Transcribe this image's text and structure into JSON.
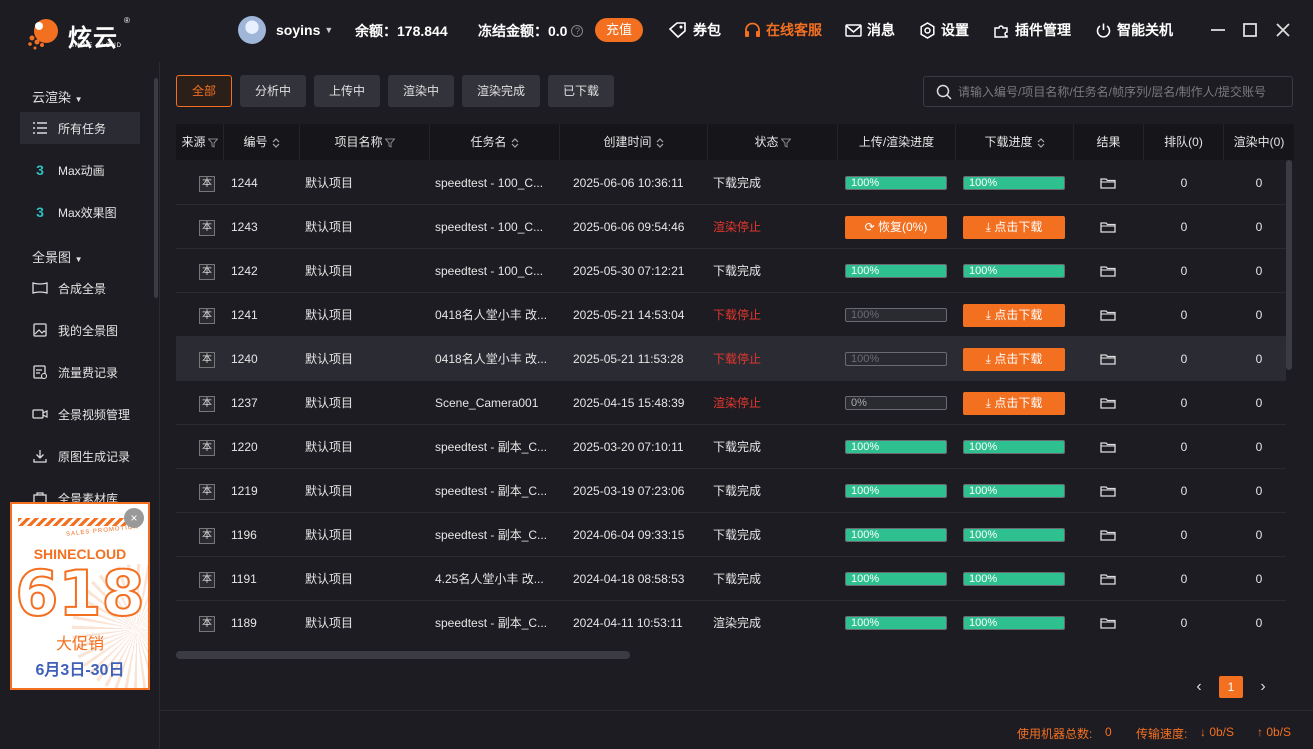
{
  "app": {
    "brand": "炫云",
    "brand_sub": "SHINE CLOUD",
    "brand_reg": "®"
  },
  "header": {
    "username": "soyins",
    "balance": "余额：178.844",
    "frozen": "冻结金额：0.0",
    "help_mark": "?",
    "recharge": "充值",
    "nav": {
      "coupon": "券包",
      "support": "在线客服",
      "message": "消息",
      "settings": "设置",
      "plugins": "插件管理",
      "shutdown": "智能关机"
    }
  },
  "sidebar": {
    "group_cloud": "云渲染",
    "all_tasks": "所有任务",
    "max_anim": "Max动画",
    "max_effect": "Max效果图",
    "group_pano": "全景图",
    "compose": "合成全景",
    "my_pano": "我的全景图",
    "traffic": "流量费记录",
    "video": "全景视频管理",
    "origin": "原图生成记录",
    "material": "全景素材库"
  },
  "promo": {
    "small": "SALES PROMOTION",
    "brand": "SHINECLOUD",
    "big": "618",
    "sale": "大促销",
    "date": "6月3日-30日",
    "close": "×"
  },
  "filters": [
    "全部",
    "分析中",
    "上传中",
    "渲染中",
    "渲染完成",
    "已下载"
  ],
  "search": {
    "placeholder": "请输入编号/项目名称/任务名/帧序列/层名/制作人/提交账号"
  },
  "columns": {
    "source": "来源",
    "id": "编号",
    "project": "项目名称",
    "task": "任务名",
    "created": "创建时间",
    "status": "状态",
    "progress": "上传/渲染进度",
    "download": "下载进度",
    "result": "结果",
    "queued": "排队(0)",
    "rendering": "渲染中(0)"
  },
  "rows": [
    {
      "src": "本",
      "id": "1244",
      "project": "默认项目",
      "task": "speedtest - 100_C...",
      "created": "2025-06-06 10:36:11",
      "status": "下载完成",
      "status_type": "normal",
      "progress": {
        "type": "bar",
        "value": 100,
        "text": "100%"
      },
      "download": {
        "type": "bar",
        "value": 100,
        "text": "100%"
      },
      "queued": "0",
      "rendering": "0"
    },
    {
      "src": "本",
      "id": "1243",
      "project": "默认项目",
      "task": "speedtest - 100_C...",
      "created": "2025-06-06 09:54:46",
      "status": "渲染停止",
      "status_type": "red",
      "progress": {
        "type": "button",
        "text": "恢复(0%)"
      },
      "download": {
        "type": "button",
        "text": "点击下载"
      },
      "queued": "0",
      "rendering": "0"
    },
    {
      "src": "本",
      "id": "1242",
      "project": "默认项目",
      "task": "speedtest - 100_C...",
      "created": "2025-05-30 07:12:21",
      "status": "下载完成",
      "status_type": "normal",
      "progress": {
        "type": "bar",
        "value": 100,
        "text": "100%"
      },
      "download": {
        "type": "bar",
        "value": 100,
        "text": "100%"
      },
      "queued": "0",
      "rendering": "0"
    },
    {
      "src": "本",
      "id": "1241",
      "project": "默认项目",
      "task": "0418名人堂小丰 改...",
      "created": "2025-05-21 14:53:04",
      "status": "下载停止",
      "status_type": "red",
      "progress": {
        "type": "bar",
        "value": 0,
        "text": "100%",
        "style": "empty"
      },
      "download": {
        "type": "button",
        "text": "点击下载"
      },
      "queued": "0",
      "rendering": "0"
    },
    {
      "src": "本",
      "id": "1240",
      "project": "默认项目",
      "task": "0418名人堂小丰 改...",
      "created": "2025-05-21 11:53:28",
      "status": "下载停止",
      "status_type": "red",
      "progress": {
        "type": "bar",
        "value": 0,
        "text": "100%",
        "style": "empty"
      },
      "download": {
        "type": "button",
        "text": "点击下载"
      },
      "queued": "0",
      "rendering": "0",
      "highlight": true
    },
    {
      "src": "本",
      "id": "1237",
      "project": "默认项目",
      "task": "Scene_Camera001",
      "created": "2025-04-15 15:48:39",
      "status": "渲染停止",
      "status_type": "red",
      "progress": {
        "type": "bar",
        "value": 0,
        "text": "0%",
        "style": "zero"
      },
      "download": {
        "type": "button",
        "text": "点击下载"
      },
      "queued": "0",
      "rendering": "0"
    },
    {
      "src": "本",
      "id": "1220",
      "project": "默认项目",
      "task": "speedtest - 副本_C...",
      "created": "2025-03-20 07:10:11",
      "status": "下载完成",
      "status_type": "normal",
      "progress": {
        "type": "bar",
        "value": 100,
        "text": "100%"
      },
      "download": {
        "type": "bar",
        "value": 100,
        "text": "100%"
      },
      "queued": "0",
      "rendering": "0"
    },
    {
      "src": "本",
      "id": "1219",
      "project": "默认项目",
      "task": "speedtest - 副本_C...",
      "created": "2025-03-19 07:23:06",
      "status": "下载完成",
      "status_type": "normal",
      "progress": {
        "type": "bar",
        "value": 100,
        "text": "100%"
      },
      "download": {
        "type": "bar",
        "value": 100,
        "text": "100%"
      },
      "queued": "0",
      "rendering": "0"
    },
    {
      "src": "本",
      "id": "1196",
      "project": "默认项目",
      "task": "speedtest - 副本_C...",
      "created": "2024-06-04 09:33:15",
      "status": "下载完成",
      "status_type": "normal",
      "progress": {
        "type": "bar",
        "value": 100,
        "text": "100%"
      },
      "download": {
        "type": "bar",
        "value": 100,
        "text": "100%"
      },
      "queued": "0",
      "rendering": "0"
    },
    {
      "src": "本",
      "id": "1191",
      "project": "默认项目",
      "task": "4.25名人堂小丰 改...",
      "created": "2024-04-18 08:58:53",
      "status": "下载完成",
      "status_type": "normal",
      "progress": {
        "type": "bar",
        "value": 100,
        "text": "100%"
      },
      "download": {
        "type": "bar",
        "value": 100,
        "text": "100%"
      },
      "queued": "0",
      "rendering": "0"
    },
    {
      "src": "本",
      "id": "1189",
      "project": "默认项目",
      "task": "speedtest - 副本_C...",
      "created": "2024-04-11 10:53:11",
      "status": "渲染完成",
      "status_type": "normal",
      "progress": {
        "type": "bar",
        "value": 100,
        "text": "100%"
      },
      "download": {
        "type": "bar",
        "value": 100,
        "text": "100%"
      },
      "queued": "0",
      "rendering": "0"
    }
  ],
  "pager": {
    "prev": "‹",
    "current": "1",
    "next": "›"
  },
  "footer": {
    "machines_label": "使用机器总数:",
    "machines_value": "0",
    "speed_label": "传输速度:",
    "down_speed": "↓ 0b/S",
    "up_speed": "↑ 0b/S"
  },
  "colors": {
    "accent": "#f37021",
    "success": "#2ec08f",
    "danger": "#e5372f",
    "bg": "#1c1c22"
  }
}
